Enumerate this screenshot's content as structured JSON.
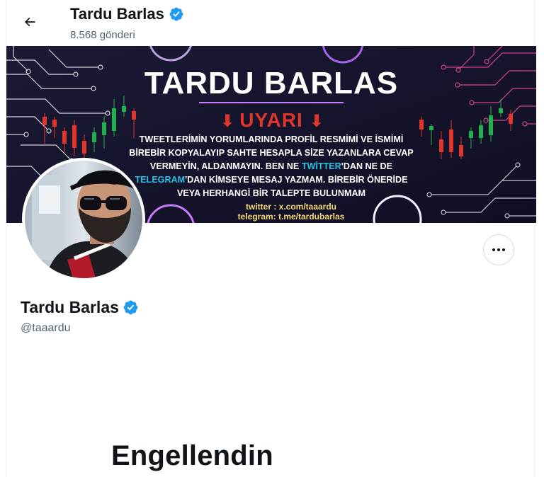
{
  "header": {
    "back_icon": "arrow-left-icon",
    "title": "Tardu Barlas",
    "posts_count": "8.568 gönderi",
    "verified_icon": "verified-badge-icon",
    "verified_color": "#1d9bf0"
  },
  "banner": {
    "title": "TARDU BARLAS",
    "warning": "UYARI",
    "line1": "TWEETLERİMİN YORUMLARINDA PROFİL RESMİMİ VE İSMİMİ",
    "line2": "BİREBİR KOPYALAYIP SAHTE HESAPLA SİZE YAZANLARA CEVAP",
    "line3": "VERMEYİN, ALDANMAYIN. BEN NE",
    "line3_twitter": "TWİTTER",
    "line3_end": "'DAN NE DE",
    "line4_telegram": "TELEGRAM",
    "line4_end": "'DAN KİMSEYE MESAJ YAZMAM. BİREBİR ÖNERİDE",
    "line5": "VEYA HERHANGİ BİR TALEPTE BULUNMAM",
    "twitter_link": "twitter : x.com/taaardu",
    "telegram_link": "telegram: t.me/tardubarlas",
    "colors": {
      "background": "#14132a",
      "circuit_left": "#ffffff",
      "circuit_right": "#e0478f",
      "accent_red": "#e0352b",
      "accent_cyan": "#27c3e6"
    }
  },
  "profile": {
    "avatar_icon": "profile-avatar",
    "more_icon": "more-options-icon",
    "name": "Tardu Barlas",
    "handle": "@taaardu"
  },
  "status": {
    "blocked_message": "Engellendin"
  }
}
